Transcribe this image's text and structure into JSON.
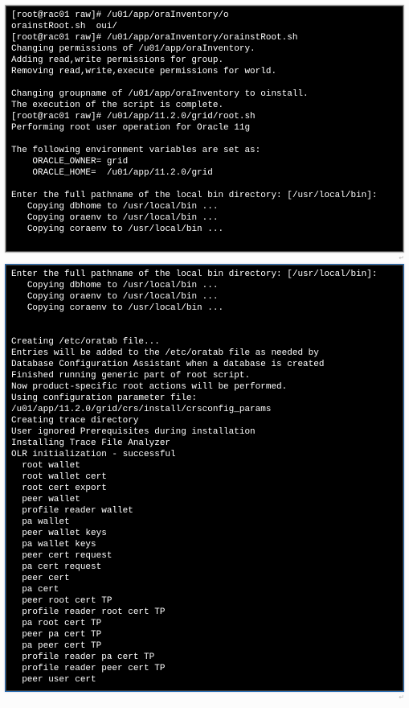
{
  "block1": {
    "lines": [
      "[root@rac01 raw]# /u01/app/oraInventory/o",
      "orainstRoot.sh  oui/",
      "[root@rac01 raw]# /u01/app/oraInventory/orainstRoot.sh",
      "Changing permissions of /u01/app/oraInventory.",
      "Adding read,write permissions for group.",
      "Removing read,write,execute permissions for world.",
      "",
      "Changing groupname of /u01/app/oraInventory to oinstall.",
      "The execution of the script is complete.",
      "[root@rac01 raw]# /u01/app/11.2.0/grid/root.sh",
      "Performing root user operation for Oracle 11g",
      "",
      "The following environment variables are set as:",
      "    ORACLE_OWNER= grid",
      "    ORACLE_HOME=  /u01/app/11.2.0/grid",
      "",
      "Enter the full pathname of the local bin directory: [/usr/local/bin]:",
      "   Copying dbhome to /usr/local/bin ...",
      "   Copying oraenv to /usr/local/bin ...",
      "   Copying coraenv to /usr/local/bin ...",
      ""
    ]
  },
  "block2": {
    "lines": [
      "Enter the full pathname of the local bin directory: [/usr/local/bin]:",
      "   Copying dbhome to /usr/local/bin ...",
      "   Copying oraenv to /usr/local/bin ...",
      "   Copying coraenv to /usr/local/bin ...",
      "",
      "",
      "Creating /etc/oratab file...",
      "Entries will be added to the /etc/oratab file as needed by",
      "Database Configuration Assistant when a database is created",
      "Finished running generic part of root script.",
      "Now product-specific root actions will be performed.",
      "Using configuration parameter file: /u01/app/11.2.0/grid/crs/install/crsconfig_params",
      "Creating trace directory",
      "User ignored Prerequisites during installation",
      "Installing Trace File Analyzer",
      "OLR initialization - successful",
      "  root wallet",
      "  root wallet cert",
      "  root cert export",
      "  peer wallet",
      "  profile reader wallet",
      "  pa wallet",
      "  peer wallet keys",
      "  pa wallet keys",
      "  peer cert request",
      "  pa cert request",
      "  peer cert",
      "  pa cert",
      "  peer root cert TP",
      "  profile reader root cert TP",
      "  pa root cert TP",
      "  peer pa cert TP",
      "  pa peer cert TP",
      "  profile reader pa cert TP",
      "  profile reader peer cert TP",
      "  peer user cert"
    ]
  }
}
